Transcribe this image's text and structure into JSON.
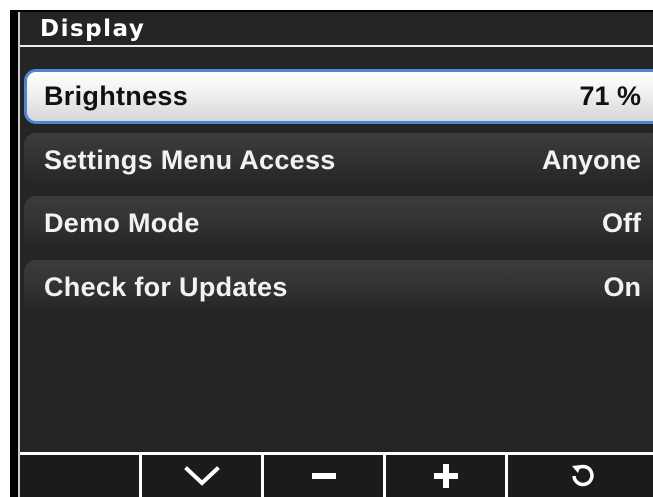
{
  "header": {
    "title": "Display"
  },
  "menu": {
    "items": [
      {
        "label": "Brightness",
        "value": "71 %",
        "selected": true
      },
      {
        "label": "Settings Menu Access",
        "value": "Anyone",
        "selected": false
      },
      {
        "label": "Demo Mode",
        "value": "Off",
        "selected": false
      },
      {
        "label": "Check for Updates",
        "value": "On",
        "selected": false
      }
    ]
  },
  "softkeys": [
    {
      "icon": "blank"
    },
    {
      "icon": "chevron-down-icon"
    },
    {
      "icon": "minus-icon"
    },
    {
      "icon": "plus-icon"
    },
    {
      "icon": "back-icon"
    }
  ],
  "colors": {
    "selection_border": "#4f86d6",
    "background": "#252525",
    "text": "#f2f2f2"
  }
}
